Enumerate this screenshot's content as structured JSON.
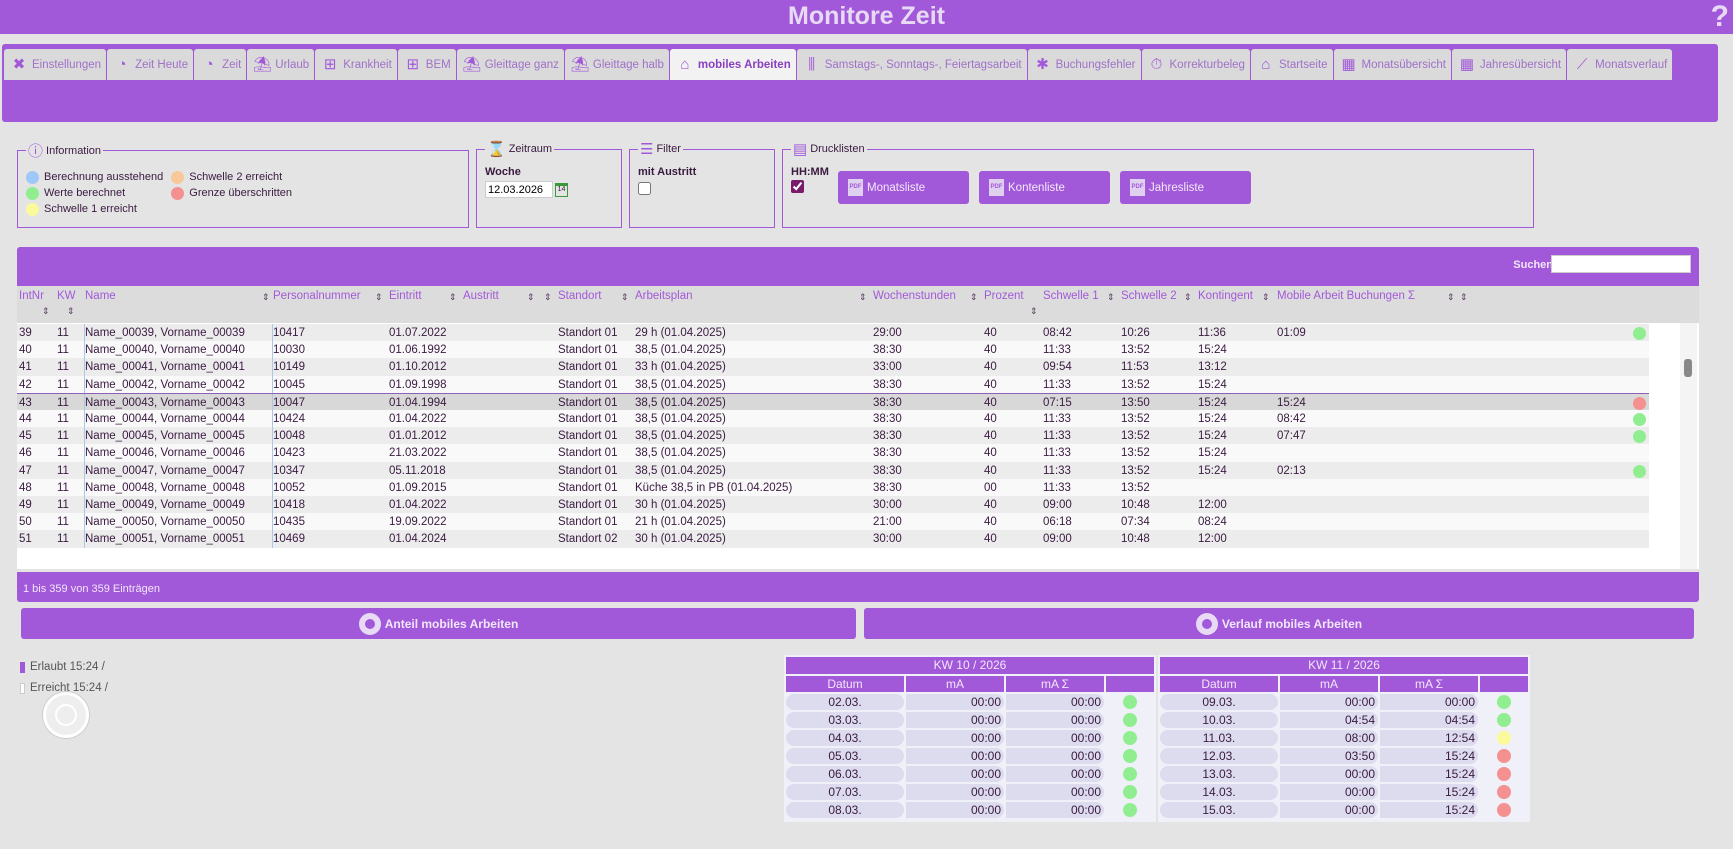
{
  "app": {
    "title": "Monitore Zeit",
    "help": "?"
  },
  "tabs": [
    {
      "label": "Einstellungen",
      "icon": "tools-icon",
      "glyph": "✖"
    },
    {
      "label": "Zeit Heute",
      "icon": "clock-icon",
      "glyph": "◔"
    },
    {
      "label": "Zeit",
      "icon": "clock-icon",
      "glyph": "◔"
    },
    {
      "label": "Urlaub",
      "icon": "umbrella-icon",
      "glyph": "⛱"
    },
    {
      "label": "Krankheit",
      "icon": "medical-icon",
      "glyph": "⊞"
    },
    {
      "label": "BEM",
      "icon": "medical-icon",
      "glyph": "⊞"
    },
    {
      "label": "Gleittage ganz",
      "icon": "umbrella-icon",
      "glyph": "⛱"
    },
    {
      "label": "Gleittage halb",
      "icon": "umbrella-icon",
      "glyph": "⛱"
    },
    {
      "label": "mobiles Arbeiten",
      "icon": "home-laptop-icon",
      "glyph": "⌂",
      "active": true
    },
    {
      "label": "Samstags-, Sonntags-, Feiertagsarbeit",
      "icon": "dumbbell-icon",
      "glyph": "⫼"
    },
    {
      "label": "Buchungsfehler",
      "icon": "bug-icon",
      "glyph": "✱"
    },
    {
      "label": "Korrekturbeleg",
      "icon": "stopwatch-icon",
      "glyph": "⏱"
    },
    {
      "label": "Startseite",
      "icon": "home-icon",
      "glyph": "⌂"
    },
    {
      "label": "Monatsübersicht",
      "icon": "calendar-icon",
      "glyph": "▦"
    },
    {
      "label": "Jahresübersicht",
      "icon": "calendar-icon",
      "glyph": "▦"
    },
    {
      "label": "Monatsverlauf",
      "icon": "chart-line-icon",
      "glyph": "⟋"
    }
  ],
  "information": {
    "title": "Information",
    "legend": [
      {
        "label": "Berechnung ausstehend",
        "color": "#9ec8f8"
      },
      {
        "label": "Werte berechnet",
        "color": "#90ee90"
      },
      {
        "label": "Schwelle 1 erreicht",
        "color": "#fafa9a"
      },
      {
        "label": "Schwelle 2 erreicht",
        "color": "#f8c898"
      },
      {
        "label": "Grenze überschritten",
        "color": "#f49090"
      }
    ]
  },
  "zeitraum": {
    "title": "Zeitraum",
    "label": "Woche",
    "value": "12.03.2026",
    "cal": "14"
  },
  "filter": {
    "title": "Filter",
    "label": "mit Austritt"
  },
  "drucklisten": {
    "title": "Drucklisten",
    "hhmm": "HH:MM",
    "pdf": "PDF",
    "buttons": [
      "Monatsliste",
      "Kontenliste",
      "Jahresliste"
    ]
  },
  "table": {
    "search_label": "Suchen",
    "columns": [
      "IntNr",
      "KW",
      "Name",
      "Personalnummer",
      "Eintritt",
      "Austritt",
      "",
      "Standort",
      "Arbeitsplan",
      "Wochenstunden",
      "Prozent",
      "Schwelle 1",
      "Schwelle 2",
      "Kontingent",
      "Mobile Arbeit Buchungen Σ"
    ],
    "rows": [
      [
        "39",
        "11",
        "Name_00039, Vorname_00039",
        "10417",
        "01.07.2022",
        "",
        "",
        "Standort 01",
        "29 h (01.04.2025)",
        "29:00",
        "40",
        "08:42",
        "10:26",
        "11:36",
        "01:09",
        "#90ee90"
      ],
      [
        "40",
        "11",
        "Name_00040, Vorname_00040",
        "10030",
        "01.06.1992",
        "",
        "",
        "Standort 01",
        "38,5 (01.04.2025)",
        "38:30",
        "40",
        "11:33",
        "13:52",
        "15:24",
        "",
        ""
      ],
      [
        "41",
        "11",
        "Name_00041, Vorname_00041",
        "10149",
        "01.10.2012",
        "",
        "",
        "Standort 01",
        "33 h (01.04.2025)",
        "33:00",
        "40",
        "09:54",
        "11:53",
        "13:12",
        "",
        ""
      ],
      [
        "42",
        "11",
        "Name_00042, Vorname_00042",
        "10045",
        "01.09.1998",
        "",
        "",
        "Standort 01",
        "38,5 (01.04.2025)",
        "38:30",
        "40",
        "11:33",
        "13:52",
        "15:24",
        "",
        ""
      ],
      [
        "43",
        "11",
        "Name_00043, Vorname_00043",
        "10047",
        "01.04.1994",
        "",
        "",
        "Standort 01",
        "38,5 (01.04.2025)",
        "38:30",
        "40",
        "07:15",
        "13:50",
        "15:24",
        "15:24",
        "#f49090"
      ],
      [
        "44",
        "11",
        "Name_00044, Vorname_00044",
        "10424",
        "01.04.2022",
        "",
        "",
        "Standort 01",
        "38,5 (01.04.2025)",
        "38:30",
        "40",
        "11:33",
        "13:52",
        "15:24",
        "08:42",
        "#90ee90"
      ],
      [
        "45",
        "11",
        "Name_00045, Vorname_00045",
        "10048",
        "01.01.2012",
        "",
        "",
        "Standort 01",
        "38,5 (01.04.2025)",
        "38:30",
        "40",
        "11:33",
        "13:52",
        "15:24",
        "07:47",
        "#90ee90"
      ],
      [
        "46",
        "11",
        "Name_00046, Vorname_00046",
        "10423",
        "21.03.2022",
        "",
        "",
        "Standort 01",
        "38,5 (01.04.2025)",
        "38:30",
        "40",
        "11:33",
        "13:52",
        "15:24",
        "",
        ""
      ],
      [
        "47",
        "11",
        "Name_00047, Vorname_00047",
        "10347",
        "05.11.2018",
        "",
        "",
        "Standort 01",
        "38,5 (01.04.2025)",
        "38:30",
        "40",
        "11:33",
        "13:52",
        "15:24",
        "02:13",
        "#90ee90"
      ],
      [
        "48",
        "11",
        "Name_00048, Vorname_00048",
        "10052",
        "01.09.2015",
        "",
        "",
        "Standort 01",
        "Küche 38,5 in PB (01.04.2025)",
        "38:30",
        "00",
        "11:33",
        "13:52",
        "",
        "",
        ""
      ],
      [
        "49",
        "11",
        "Name_00049, Vorname_00049",
        "10418",
        "01.04.2022",
        "",
        "",
        "Standort 01",
        "30 h (01.04.2025)",
        "30:00",
        "40",
        "09:00",
        "10:48",
        "12:00",
        "",
        ""
      ],
      [
        "50",
        "11",
        "Name_00050, Vorname_00050",
        "10435",
        "19.09.2022",
        "",
        "",
        "Standort 01",
        "21 h (01.04.2025)",
        "21:00",
        "40",
        "06:18",
        "07:34",
        "08:24",
        "",
        ""
      ],
      [
        "51",
        "11",
        "Name_00051, Vorname_00051",
        "10469",
        "01.04.2024",
        "",
        "",
        "Standort 02",
        "30 h (01.04.2025)",
        "30:00",
        "40",
        "09:00",
        "10:48",
        "12:00",
        "",
        ""
      ]
    ],
    "info": "1 bis 359 von 359 Einträgen"
  },
  "anteil": {
    "title": "Anteil mobiles Arbeiten",
    "erlaubt": "Erlaubt 15:24 /",
    "erreicht": "Erreicht 15:24 /"
  },
  "verlauf": {
    "title": "Verlauf mobiles Arbeiten",
    "headers": [
      "Datum",
      "mA",
      "mA Σ",
      ""
    ],
    "weeks": [
      {
        "title": "KW 10 / 2026",
        "rows": [
          [
            "02.03.",
            "00:00",
            "00:00",
            "#90ee90"
          ],
          [
            "03.03.",
            "00:00",
            "00:00",
            "#90ee90"
          ],
          [
            "04.03.",
            "00:00",
            "00:00",
            "#90ee90"
          ],
          [
            "05.03.",
            "00:00",
            "00:00",
            "#90ee90"
          ],
          [
            "06.03.",
            "00:00",
            "00:00",
            "#90ee90"
          ],
          [
            "07.03.",
            "00:00",
            "00:00",
            "#90ee90"
          ],
          [
            "08.03.",
            "00:00",
            "00:00",
            "#90ee90"
          ]
        ]
      },
      {
        "title": "KW 11 / 2026",
        "rows": [
          [
            "09.03.",
            "00:00",
            "00:00",
            "#90ee90"
          ],
          [
            "10.03.",
            "04:54",
            "04:54",
            "#90ee90"
          ],
          [
            "11.03.",
            "08:00",
            "12:54",
            "#fafa9a"
          ],
          [
            "12.03.",
            "03:50",
            "15:24",
            "#f49090"
          ],
          [
            "13.03.",
            "00:00",
            "15:24",
            "#f49090"
          ],
          [
            "14.03.",
            "00:00",
            "15:24",
            "#f49090"
          ],
          [
            "15.03.",
            "00:00",
            "15:24",
            "#f49090"
          ]
        ]
      }
    ]
  }
}
